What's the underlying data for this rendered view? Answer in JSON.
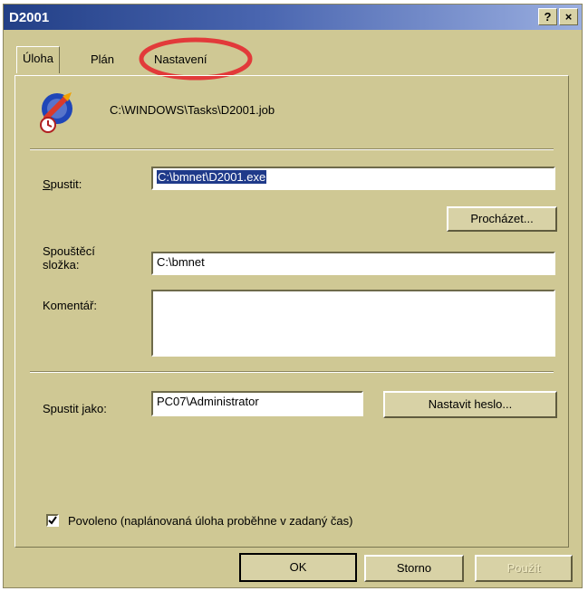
{
  "window": {
    "title": "D2001",
    "help_label": "?",
    "close_label": "×"
  },
  "tabs": [
    {
      "label": "Úloha",
      "active": true
    },
    {
      "label": "Plán",
      "active": false
    },
    {
      "label": "Nastavení",
      "active": false,
      "highlighted": true
    }
  ],
  "task": {
    "icon": "scheduled-task-icon",
    "path": "C:\\WINDOWS\\Tasks\\D2001.job"
  },
  "run": {
    "label": "Spustit:",
    "value": "C:\\bmnet\\D2001.exe",
    "browse_label": "Procházet..."
  },
  "start_in": {
    "label_line1": "Spouštěcí",
    "label_line2": "složka:",
    "value": "C:\\bmnet"
  },
  "comment": {
    "label": "Komentář:",
    "value": ""
  },
  "run_as": {
    "label": "Spustit jako:",
    "value": "PC07\\Administrator",
    "set_password_label": "Nastavit heslo..."
  },
  "enabled": {
    "checked": true,
    "label": "Povoleno (naplánovaná úloha proběhne v zadaný čas)"
  },
  "footer": {
    "ok_label": "OK",
    "cancel_label": "Storno",
    "apply_label": "Použít"
  },
  "colors": {
    "highlight_circle": "#e23a3a",
    "dialog_bg": "#cfc894",
    "title_bar": "#223f86"
  }
}
